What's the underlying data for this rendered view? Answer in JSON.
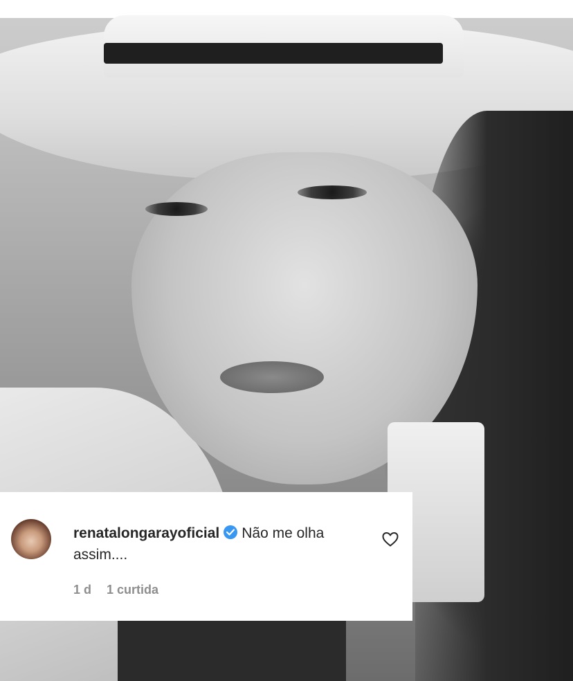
{
  "comment": {
    "username": "renatalongarayoficial",
    "text": "Não me olha assim....",
    "time": "1 d",
    "likes": "1 curtida"
  },
  "icons": {
    "verified": "verified-badge-icon",
    "like": "heart-outline-icon"
  },
  "colors": {
    "verified_blue": "#3897f0",
    "text": "#262626",
    "meta_text": "#8e8e8e"
  }
}
